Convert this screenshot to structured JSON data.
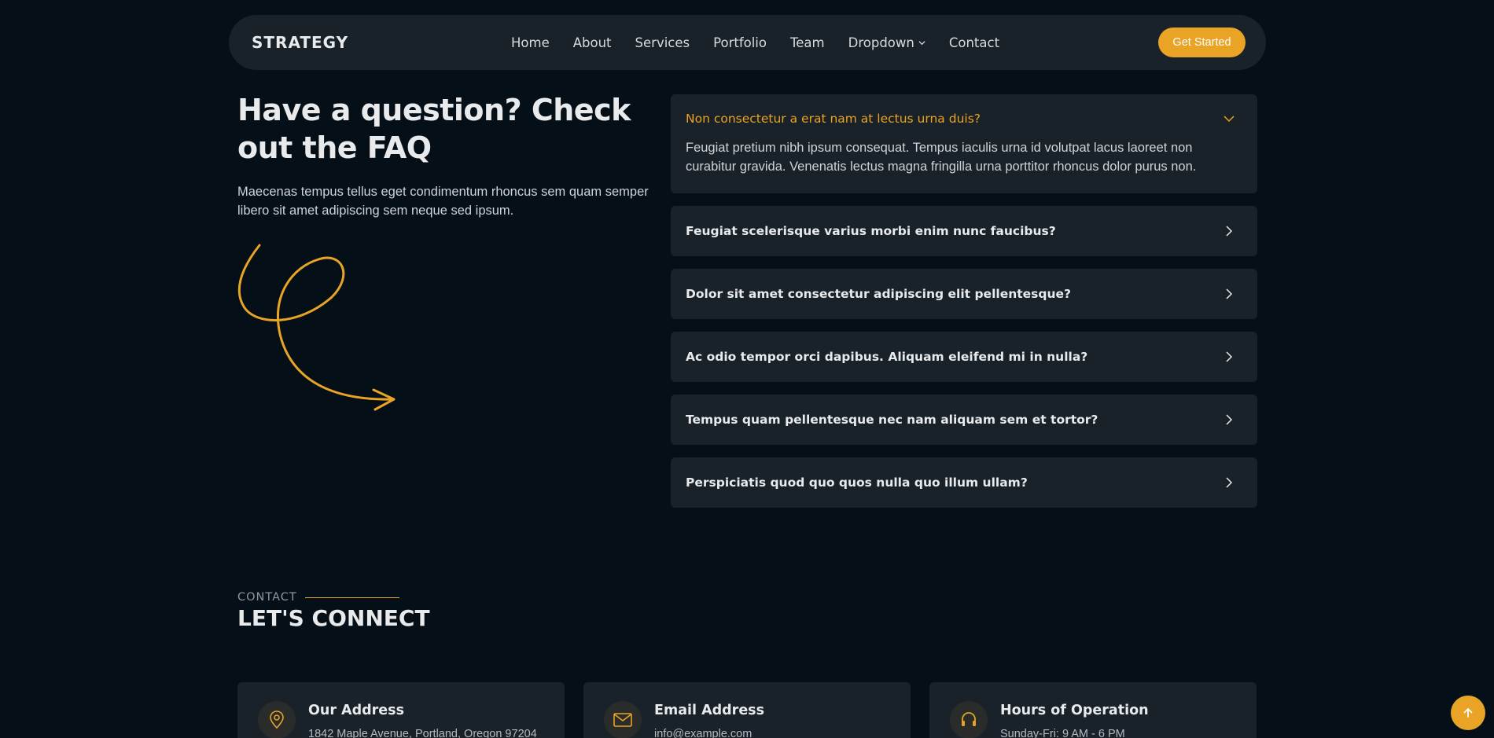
{
  "header": {
    "logo": "STRATEGY",
    "nav": [
      "Home",
      "About",
      "Services",
      "Portfolio",
      "Team",
      "Dropdown",
      "Contact"
    ],
    "cta": "Get Started"
  },
  "faq": {
    "title": "Have a question? Check out the FAQ",
    "description": "Maecenas tempus tellus eget condimentum rhoncus sem quam semper libero sit amet adipiscing sem neque sed ipsum.",
    "items": [
      {
        "question": "Non consectetur a erat nam at lectus urna duis?",
        "answer": "Feugiat pretium nibh ipsum consequat. Tempus iaculis urna id volutpat lacus laoreet non curabitur gravida. Venenatis lectus magna fringilla urna porttitor rhoncus dolor purus non."
      },
      {
        "question": "Feugiat scelerisque varius morbi enim nunc faucibus?"
      },
      {
        "question": "Dolor sit amet consectetur adipiscing elit pellentesque?"
      },
      {
        "question": "Ac odio tempor orci dapibus. Aliquam eleifend mi in nulla?"
      },
      {
        "question": "Tempus quam pellentesque nec nam aliquam sem et tortor?"
      },
      {
        "question": "Perspiciatis quod quo quos nulla quo illum ullam?"
      }
    ]
  },
  "contact": {
    "eyebrow": "CONTACT",
    "title": "LET'S CONNECT",
    "cards": [
      {
        "icon": "map-pin-icon",
        "title": "Our Address",
        "text": "1842 Maple Avenue, Portland, Oregon 97204"
      },
      {
        "icon": "envelope-icon",
        "title": "Email Address",
        "text": "info@example.com"
      },
      {
        "icon": "headset-icon",
        "title": "Hours of Operation",
        "text": "Sunday-Fri: 9 AM - 6 PM"
      }
    ]
  },
  "colors": {
    "accent": "#e9a325",
    "background": "#040f17",
    "surface": "#1a2229"
  }
}
